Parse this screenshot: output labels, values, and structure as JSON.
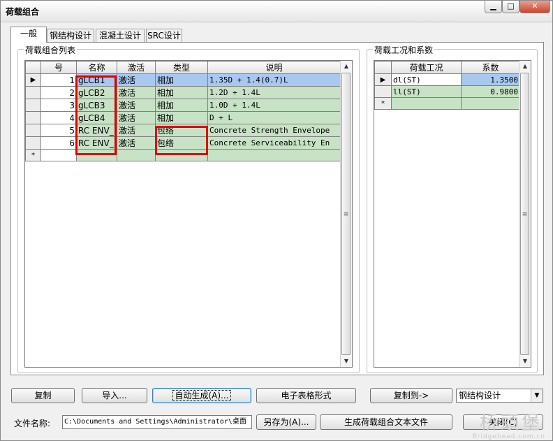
{
  "window": {
    "title": "荷载组合",
    "min": "▁",
    "max": "□",
    "close": "✕"
  },
  "tabs": [
    "一般",
    "钢结构设计",
    "混凝土设计",
    "SRC设计"
  ],
  "left_group": {
    "label": "荷载组合列表"
  },
  "right_group": {
    "label": "荷载工况和系数"
  },
  "combo_table": {
    "headers": [
      "号",
      "名称",
      "激活",
      "类型",
      "说明"
    ],
    "rows": [
      {
        "marker": "▶",
        "no": "1",
        "name": "gLCB1",
        "active": "激活",
        "type": "相加",
        "desc": "1.35D + 1.4(0.7)L"
      },
      {
        "marker": "",
        "no": "2",
        "name": "gLCB2",
        "active": "激活",
        "type": "相加",
        "desc": "1.2D + 1.4L"
      },
      {
        "marker": "",
        "no": "3",
        "name": "gLCB3",
        "active": "激活",
        "type": "相加",
        "desc": "1.0D + 1.4L"
      },
      {
        "marker": "",
        "no": "4",
        "name": "gLCB4",
        "active": "激活",
        "type": "相加",
        "desc": "D + L"
      },
      {
        "marker": "",
        "no": "5",
        "name": "RC ENV_",
        "active": "激活",
        "type": "包络",
        "desc": "Concrete Strength Envelope"
      },
      {
        "marker": "",
        "no": "6",
        "name": "RC ENV_",
        "active": "激活",
        "type": "包络",
        "desc": "Concrete Serviceability En"
      }
    ],
    "new_marker": "*"
  },
  "factor_table": {
    "headers": [
      "荷载工况",
      "系数"
    ],
    "rows": [
      {
        "marker": "▶",
        "case": "dl(ST)",
        "factor": "1.3500"
      },
      {
        "marker": "",
        "case": "ll(ST)",
        "factor": "0.9800"
      }
    ],
    "new_marker": "*"
  },
  "buttons": {
    "copy": "复制",
    "import": "导入...",
    "auto": "自动生成(A)...",
    "spreadsheet": "电子表格形式",
    "copy_to": "复制到->",
    "save_as": "另存为(A)...",
    "gen_text": "生成荷载组合文本文件",
    "close": "关闭(C)"
  },
  "copy_target": {
    "selected": "钢结构设计"
  },
  "file": {
    "label": "文件名称:",
    "value": "C:\\Documents and Settings\\Administrator\\桌面"
  },
  "watermark": {
    "text": "桥頭堡",
    "url": "Bridgehead.com.cn"
  },
  "colors": {
    "cell_green": "#c7e2c5",
    "selected_blue": "#a8c8f0",
    "highlight_red": "#e00000"
  }
}
